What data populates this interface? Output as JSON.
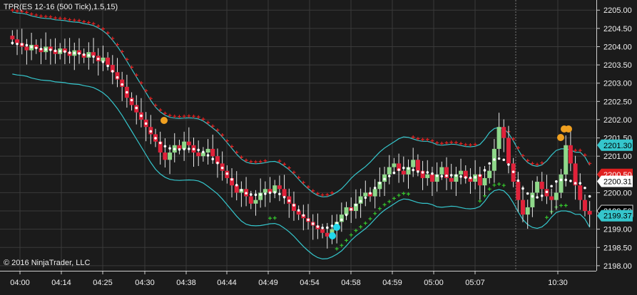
{
  "chart": {
    "title": "TPR(ES 12-16 (500 Tick),1.5,15)",
    "copyright": "© 2016 NinjaTrader, LLC",
    "x_ticks": [
      "04:00",
      "04:14",
      "04:25",
      "04:30",
      "04:38",
      "04:44",
      "04:49",
      "04:54",
      "04:58",
      "04:59",
      "05:00",
      "05:07",
      "10:30"
    ],
    "y_ticks": [
      "2205.00",
      "2204.50",
      "2204.00",
      "2203.50",
      "2203.00",
      "2202.50",
      "2202.00",
      "2201.50",
      "2201.00",
      "2200.50",
      "2200.00",
      "2199.50",
      "2199.00",
      "2198.50",
      "2198.00"
    ],
    "y_range": [
      2197.9,
      2205.2
    ],
    "price_tags": [
      {
        "label": "2201.30",
        "value": 2201.3,
        "style": "cyan"
      },
      {
        "label": "2200.50",
        "value": 2200.5,
        "style": "red"
      },
      {
        "label": "2200.31",
        "value": 2200.31,
        "style": "white"
      },
      {
        "label": "2199.50",
        "value": 2199.5,
        "style": "black"
      },
      {
        "label": "2199.37",
        "value": 2199.37,
        "style": "cyan"
      }
    ],
    "colors": {
      "background": "#1b1b1b",
      "grid": "#3a3a3a",
      "axis_text": "#f0f0f0",
      "up_candle": "#8fd88a",
      "down_candle": "#e0223a",
      "wick": "#e8e8e8",
      "band": "#35c6cc",
      "mid_dots": "#ffffff",
      "stop_up": "#35c62d",
      "stop_down": "#e02020",
      "signal_orange": "#f0a020",
      "signal_cyan": "#22d8ec"
    }
  },
  "chart_data": {
    "type": "candlestick",
    "title": "TPR(ES 12-16 (500 Tick),1.5,15)",
    "closes": [
      2204.2,
      2204.1,
      2204.0,
      2203.9,
      2204.05,
      2203.95,
      2203.85,
      2204.0,
      2203.9,
      2203.8,
      2203.95,
      2203.85,
      2203.75,
      2203.9,
      2203.8,
      2203.7,
      2203.85,
      2203.75,
      2203.6,
      2203.7,
      2203.5,
      2203.3,
      2203.1,
      2202.9,
      2202.6,
      2202.4,
      2202.2,
      2202.0,
      2201.8,
      2201.6,
      2201.4,
      2201.1,
      2200.9,
      2201.1,
      2201.3,
      2201.2,
      2201.4,
      2201.3,
      2201.1,
      2201.0,
      2201.1,
      2201.2,
      2201.0,
      2200.8,
      2200.6,
      2200.4,
      2200.2,
      2200.0,
      2200.1,
      2199.9,
      2199.7,
      2199.8,
      2200.0,
      2200.1,
      2200.0,
      2200.2,
      2200.1,
      2199.9,
      2199.7,
      2199.5,
      2199.4,
      2199.3,
      2199.2,
      2199.1,
      2199.0,
      2198.9,
      2198.8,
      2199.0,
      2199.2,
      2199.4,
      2199.6,
      2199.5,
      2199.7,
      2199.9,
      2200.0,
      2199.9,
      2200.1,
      2200.3,
      2200.5,
      2200.7,
      2200.8,
      2200.6,
      2200.5,
      2200.7,
      2200.9,
      2200.6,
      2200.4,
      2200.5,
      2200.3,
      2200.5,
      2200.7,
      2200.4,
      2200.3,
      2200.5,
      2200.6,
      2200.4,
      2200.3,
      2200.5,
      2200.2,
      2200.4,
      2200.6,
      2201.2,
      2201.8,
      2201.5,
      2200.8,
      2200.3,
      2199.8,
      2199.4,
      2199.6,
      2200.0,
      2200.3,
      2200.1,
      2199.9,
      2199.8,
      2200.0,
      2200.5,
      2201.3,
      2200.8,
      2200.2,
      2199.8,
      2199.5,
      2199.4
    ]
  }
}
